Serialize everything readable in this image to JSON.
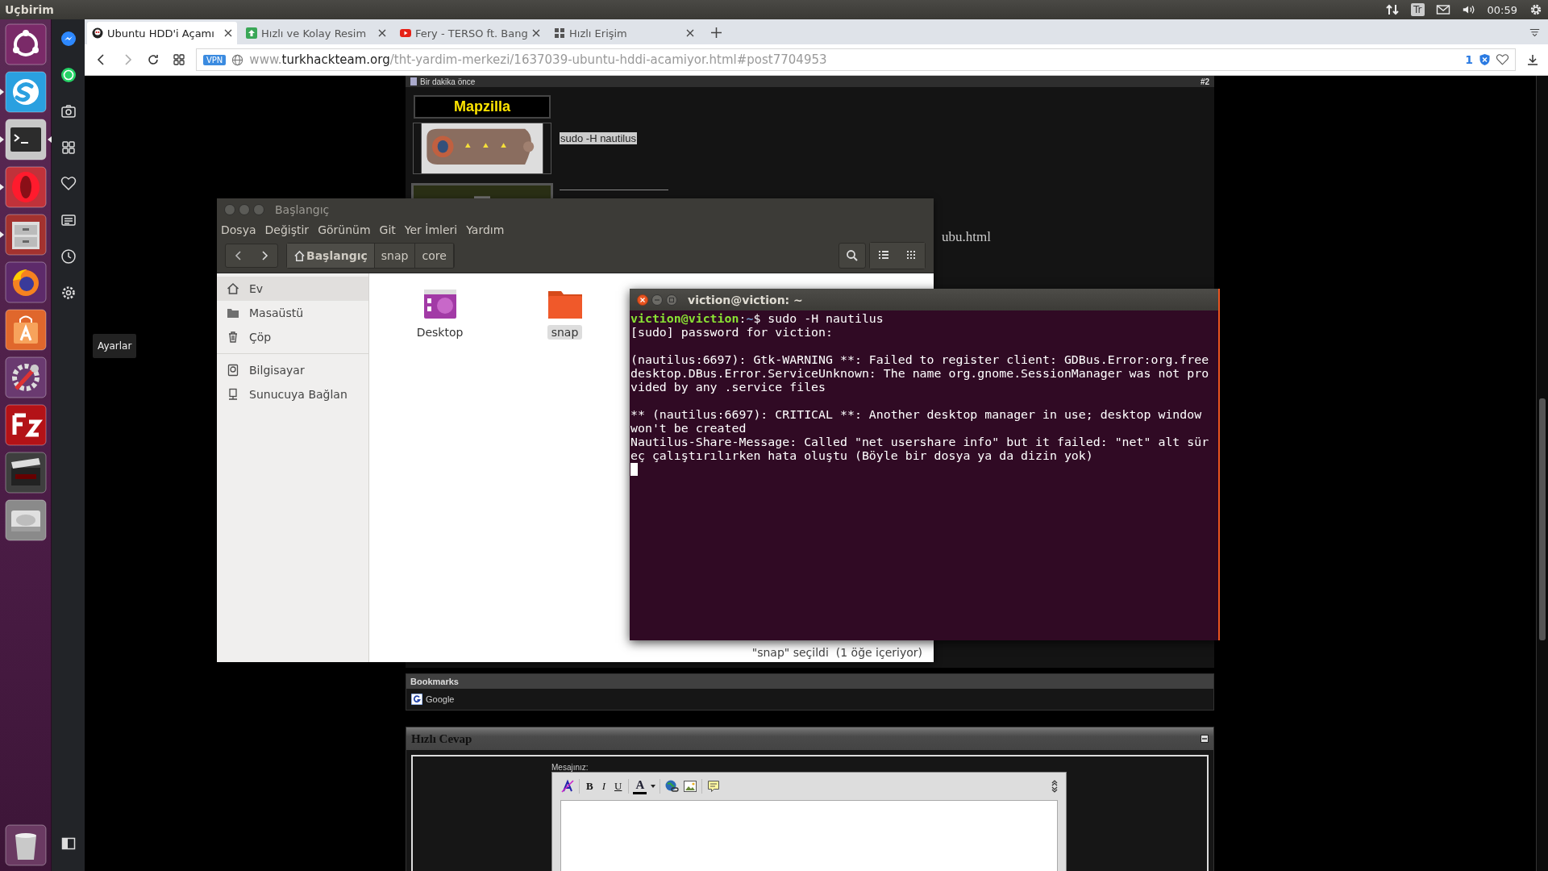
{
  "top_bar": {
    "title": "Uçbirim",
    "keyboard": "Tr",
    "time": "00:59"
  },
  "launcher": {
    "items": [
      {
        "kind": "dash",
        "running": false,
        "focused": false
      },
      {
        "kind": "skype",
        "running": true,
        "focused": false
      },
      {
        "kind": "terminal",
        "running": true,
        "focused": true
      },
      {
        "kind": "opera",
        "running": true,
        "focused": false
      },
      {
        "kind": "files",
        "running": true,
        "focused": false
      },
      {
        "kind": "firefox",
        "running": false,
        "focused": false
      },
      {
        "kind": "store",
        "running": false,
        "focused": false
      },
      {
        "kind": "tools",
        "running": false,
        "focused": false
      },
      {
        "kind": "filezilla",
        "running": false,
        "focused": false
      },
      {
        "kind": "video",
        "running": false,
        "focused": false
      },
      {
        "kind": "disk",
        "running": false,
        "focused": false
      }
    ],
    "trash": {
      "kind": "trash"
    }
  },
  "browser_sidebar": {
    "items": [
      {
        "kind": "messenger"
      },
      {
        "kind": "whatsapp"
      },
      {
        "kind": "camera"
      },
      {
        "kind": "grid"
      },
      {
        "kind": "heart"
      },
      {
        "kind": "news"
      },
      {
        "kind": "clock"
      },
      {
        "kind": "gear"
      }
    ],
    "tooltip": "Ayarlar"
  },
  "tabs": [
    {
      "title": "Ubuntu HDD'i Açamı",
      "kind": "site",
      "selected": true
    },
    {
      "title": "Hızlı ve Kolay Resim",
      "kind": "upload",
      "selected": false
    },
    {
      "title": "Fery - TERSO ft. Bang",
      "kind": "video",
      "selected": false
    },
    {
      "title": "Hızlı Erişim",
      "kind": "grid",
      "selected": false
    }
  ],
  "address_bar": {
    "vpn": "VPN",
    "prefix": "www.",
    "domain": "turkhackteam.org",
    "path": "/tht-yardim-merkezi/1637039-ubuntu-hddi-acamiyor.html#post7704953",
    "blocked_count": "1"
  },
  "post": {
    "time": "Bir dakika önce",
    "number": "#2",
    "author": "Mapzilla",
    "message": "sudo -H nautilus",
    "signature_fragment": "ubu.html"
  },
  "file_manager": {
    "title": "Başlangıç",
    "menu": [
      "Dosya",
      "Değiştir",
      "Görünüm",
      "Git",
      "Yer İmleri",
      "Yardım"
    ],
    "path": [
      {
        "label": "Başlangıç",
        "kind": "home",
        "selected": true
      },
      {
        "label": "snap",
        "kind": "folder",
        "selected": false
      },
      {
        "label": "core",
        "kind": "folder",
        "selected": false
      }
    ],
    "sidebar_groups": [
      [
        {
          "label": "Ev",
          "kind": "home",
          "selected": true
        },
        {
          "label": "Masaüstü",
          "kind": "folder",
          "selected": false
        },
        {
          "label": "Çöp",
          "kind": "trash",
          "selected": false
        }
      ],
      [
        {
          "label": "Bilgisayar",
          "kind": "computer",
          "selected": false
        },
        {
          "label": "Sunucuya Bağlan",
          "kind": "server",
          "selected": false
        }
      ]
    ],
    "files": [
      {
        "name": "Desktop",
        "kind": "desktop",
        "selected": false
      },
      {
        "name": "snap",
        "kind": "folder",
        "selected": true
      }
    ],
    "status": "\"snap\" seçildi  (1 öğe içeriyor)"
  },
  "terminal": {
    "title": "viction@viction: ~",
    "prompt": {
      "user": "viction@viction",
      "colon": ":",
      "path": "~",
      "command": "$ sudo -H nautilus"
    },
    "blocks": [
      [
        "[sudo] password for viction:"
      ],
      [
        "(nautilus:6697): Gtk-WARNING **: Failed to register client: GDBus.Error:org.free",
        "desktop.DBus.Error.ServiceUnknown: The name org.gnome.SessionManager was not pro",
        "vided by any .service files"
      ],
      [
        "** (nautilus:6697): CRITICAL **: Another desktop manager in use; desktop window",
        "won't be created",
        "Nautilus-Share-Message: Called \"net usershare info\" but it failed: \"net\" alt sür",
        "eç çalıştırılırken hata oluştu (Böyle bir dosya ya da dizin yok)"
      ]
    ]
  },
  "bookmarks": {
    "title": "Bookmarks",
    "items": [
      {
        "label": "Google"
      }
    ]
  },
  "quick_reply": {
    "title": "Hızlı Cevap",
    "message_label": "Mesajınız:",
    "format_buttons": [
      {
        "label": "B",
        "kind": "bold"
      },
      {
        "label": "I",
        "kind": "italic"
      },
      {
        "label": "U",
        "kind": "underline"
      }
    ],
    "color_button": "A"
  }
}
